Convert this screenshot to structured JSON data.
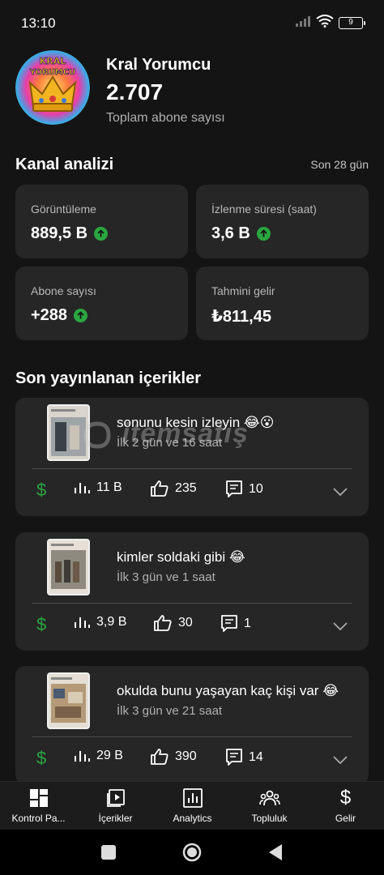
{
  "status": {
    "time": "13:10",
    "battery": "9"
  },
  "channel": {
    "name": "Kral Yorumcu",
    "avatar_text": "KRAL YORUMCU",
    "subscribers": "2.707",
    "subscribers_label": "Toplam abone sayısı"
  },
  "analytics": {
    "title": "Kanal analizi",
    "period": "Son 28 gün",
    "cards": [
      {
        "label": "Görüntüleme",
        "value": "889,5 B",
        "trend": "up"
      },
      {
        "label": "İzlenme süresi (saat)",
        "value": "3,6 B",
        "trend": "up"
      },
      {
        "label": "Abone sayısı",
        "value": "+288",
        "trend": "up"
      },
      {
        "label": "Tahmini gelir",
        "value": "₺811,45"
      }
    ]
  },
  "recent": {
    "title": "Son yayınlanan içerikler",
    "videos": [
      {
        "title": "sonunu kesin izleyin 😂😮",
        "age": "İlk 2 gün ve 16 saat",
        "views": "11 B",
        "likes": "235",
        "comments": "10"
      },
      {
        "title": "kimler soldaki gibi 😂",
        "age": "İlk 3 gün ve 1 saat",
        "views": "3,9 B",
        "likes": "30",
        "comments": "1"
      },
      {
        "title": "okulda bunu yaşayan kaç kişi var 😂",
        "age": "İlk 3 gün ve 21 saat",
        "views": "29 B",
        "likes": "390",
        "comments": "14"
      }
    ]
  },
  "watermark": "itemsatış",
  "nav": [
    {
      "label": "Kontrol Pa...",
      "icon": "dashboard-icon"
    },
    {
      "label": "İçerikler",
      "icon": "content-icon"
    },
    {
      "label": "Analytics",
      "icon": "analytics-icon"
    },
    {
      "label": "Topluluk",
      "icon": "community-icon"
    },
    {
      "label": "Gelir",
      "icon": "earn-icon"
    }
  ],
  "colors": {
    "background": "#141414",
    "card": "#262626",
    "positive": "#2ba640",
    "muted": "#b0b0b0"
  }
}
